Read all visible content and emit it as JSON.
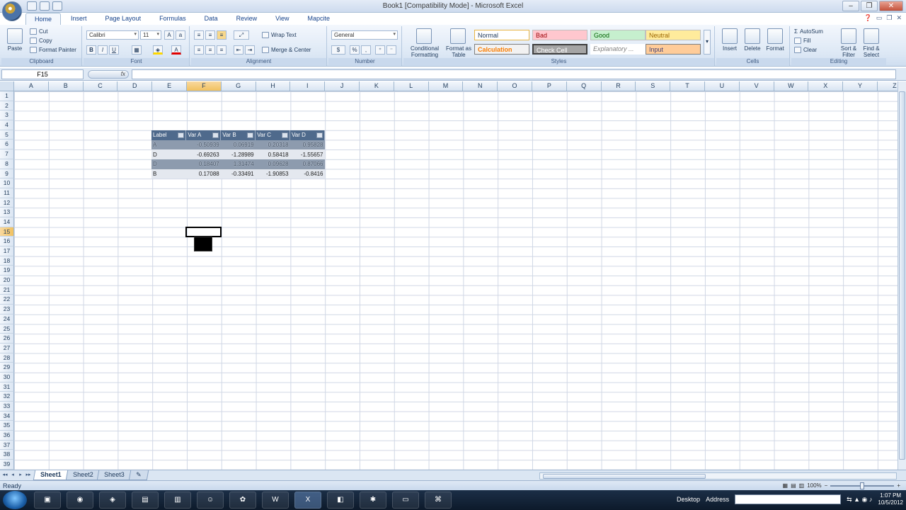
{
  "window": {
    "title": "Book1  [Compatibility Mode] - Microsoft Excel",
    "minimize": "–",
    "restore": "❐",
    "close": "✕"
  },
  "tabs": [
    "Home",
    "Insert",
    "Page Layout",
    "Formulas",
    "Data",
    "Review",
    "View",
    "Mapcite"
  ],
  "ribbon": {
    "clipboard": {
      "label": "Clipboard",
      "paste": "Paste",
      "cut": "Cut",
      "copy": "Copy",
      "format_painter": "Format Painter"
    },
    "font": {
      "label": "Font",
      "name": "Calibri",
      "size": "11",
      "bold": "B",
      "italic": "I",
      "underline": "U"
    },
    "alignment": {
      "label": "Alignment",
      "wrap_text": "Wrap Text",
      "merge_center": "Merge & Center"
    },
    "number": {
      "label": "Number",
      "format": "General"
    },
    "styles": {
      "label": "Styles",
      "conditional_formatting": "Conditional Formatting",
      "format_as_table": "Format as Table",
      "normal": "Normal",
      "bad": "Bad",
      "good": "Good",
      "neutral": "Neutral",
      "calculation": "Calculation",
      "check_cell": "Check Cell",
      "explanatory": "Explanatory ...",
      "input": "Input"
    },
    "cells": {
      "label": "Cells",
      "insert": "Insert",
      "delete": "Delete",
      "format": "Format"
    },
    "editing": {
      "label": "Editing",
      "autosum": "AutoSum",
      "fill": "Fill",
      "clear": "Clear",
      "sort_filter": "Sort & Filter",
      "find_select": "Find & Select"
    }
  },
  "formula_bar": {
    "name_box": "F15",
    "fx": "fx",
    "value": ""
  },
  "columns": [
    "A",
    "B",
    "C",
    "D",
    "E",
    "F",
    "G",
    "H",
    "I",
    "J",
    "K",
    "L",
    "M",
    "N",
    "O",
    "P",
    "Q",
    "R",
    "S",
    "T",
    "U",
    "V",
    "W",
    "X",
    "Y",
    "Z"
  ],
  "rows": [
    "1",
    "2",
    "3",
    "4",
    "5",
    "6",
    "7",
    "8",
    "9",
    "10",
    "11",
    "12",
    "13",
    "14",
    "15",
    "16",
    "17",
    "18",
    "19",
    "20",
    "21",
    "22",
    "23",
    "24",
    "25",
    "26",
    "27",
    "28",
    "29",
    "30",
    "31",
    "32",
    "33",
    "34",
    "35",
    "36",
    "37",
    "38",
    "39"
  ],
  "table": {
    "headers": [
      "Label",
      "Var A",
      "Var B",
      "Var C",
      "Var D"
    ],
    "rows": [
      [
        "A",
        "-0.50939",
        "0.06919",
        "0.20318",
        "0.95828"
      ],
      [
        "D",
        "-0.69263",
        "-1.28989",
        "0.58418",
        "-1.55657"
      ],
      [
        "D",
        "0.18407",
        "1.31474",
        "0.09628",
        "0.87066"
      ],
      [
        "B",
        "0.17088",
        "-0.33491",
        "-1.90853",
        "-0.8416"
      ]
    ]
  },
  "sheets": [
    "Sheet1",
    "Sheet2",
    "Sheet3"
  ],
  "status": {
    "text": "Ready",
    "zoom": "100%"
  },
  "taskbar": {
    "desktop": "Desktop",
    "address_label": "Address",
    "time": "1:07 PM",
    "date": "10/5/2012"
  }
}
